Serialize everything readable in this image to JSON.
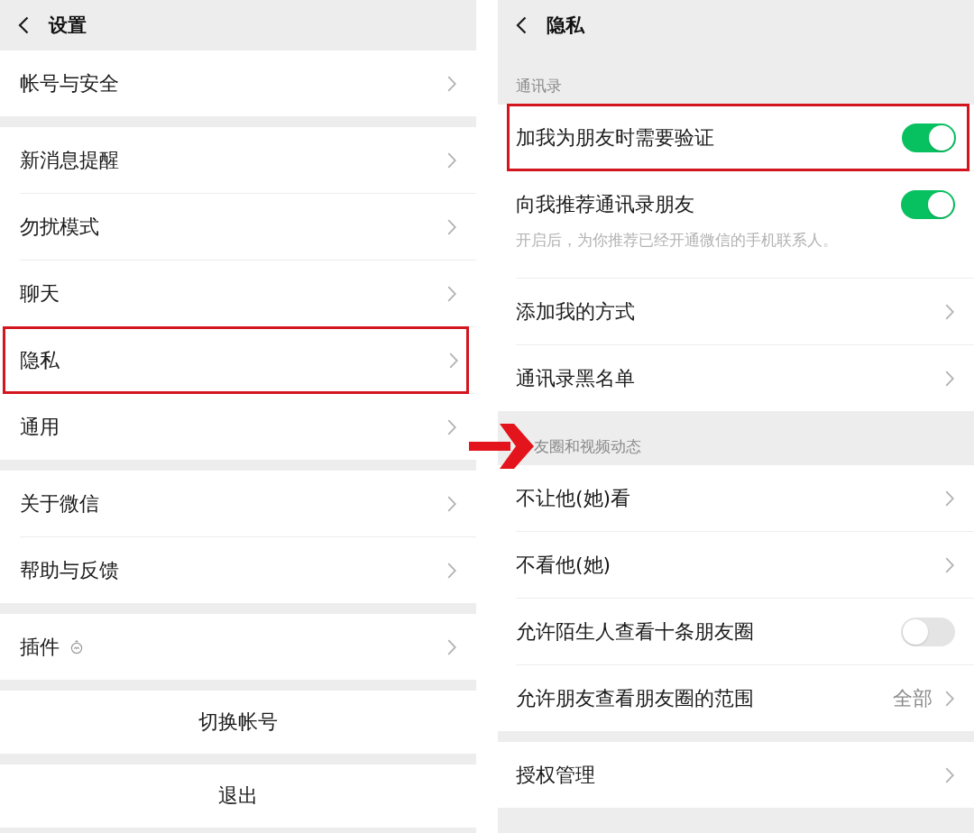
{
  "left_screen": {
    "title": "设置",
    "sections": [
      {
        "items": [
          {
            "kind": "link",
            "label": "帐号与安全",
            "highlighted": false
          }
        ]
      },
      {
        "items": [
          {
            "kind": "link",
            "label": "新消息提醒",
            "highlighted": false
          },
          {
            "kind": "link",
            "label": "勿扰模式",
            "highlighted": false
          },
          {
            "kind": "link",
            "label": "聊天",
            "highlighted": false
          },
          {
            "kind": "link",
            "label": "隐私",
            "highlighted": true
          },
          {
            "kind": "link",
            "label": "通用",
            "highlighted": false
          }
        ]
      },
      {
        "items": [
          {
            "kind": "link",
            "label": "关于微信",
            "highlighted": false
          },
          {
            "kind": "link",
            "label": "帮助与反馈",
            "highlighted": false
          }
        ]
      },
      {
        "items": [
          {
            "kind": "link_badge",
            "label": "插件",
            "highlighted": false
          }
        ]
      }
    ],
    "buttons": [
      "切换帐号",
      "退出"
    ]
  },
  "right_screen": {
    "title": "隐私",
    "sections": [
      {
        "header": "通讯录",
        "pointed": false,
        "items": [
          {
            "kind": "toggle",
            "label": "加我为朋友时需要验证",
            "on": true,
            "highlighted": true
          },
          {
            "kind": "toggle",
            "label": "向我推荐通讯录朋友",
            "on": true,
            "description": "开启后，为你推荐已经开通微信的手机联系人。",
            "highlighted": false
          },
          {
            "kind": "link",
            "label": "添加我的方式",
            "highlighted": false
          },
          {
            "kind": "link",
            "label": "通讯录黑名单",
            "highlighted": false
          }
        ]
      },
      {
        "header": "友圈和视频动态",
        "pointed": true,
        "items": [
          {
            "kind": "link",
            "label": "不让他(她)看",
            "highlighted": false
          },
          {
            "kind": "link",
            "label": "不看他(她)",
            "highlighted": false
          },
          {
            "kind": "toggle",
            "label": "允许陌生人查看十条朋友圈",
            "on": false,
            "highlighted": false
          },
          {
            "kind": "link",
            "label": "允许朋友查看朋友圈的范围",
            "value": "全部",
            "highlighted": false
          }
        ]
      },
      {
        "pointed": false,
        "items": [
          {
            "kind": "link",
            "label": "授权管理",
            "highlighted": false
          }
        ]
      }
    ]
  }
}
